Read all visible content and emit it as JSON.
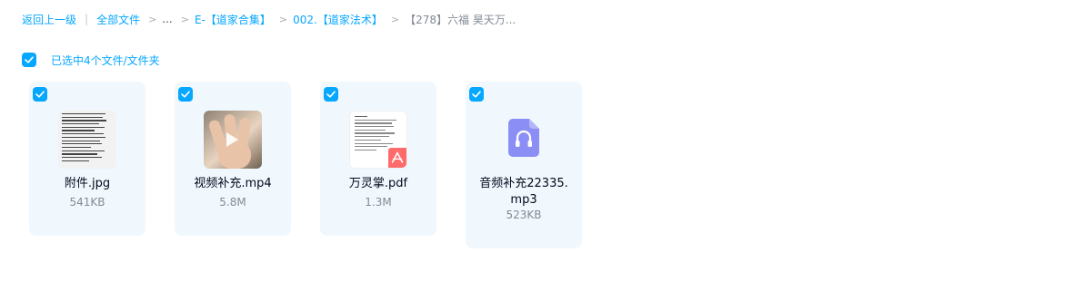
{
  "breadcrumb": {
    "back": "返回上一级",
    "divider": "|",
    "separator": ">",
    "items": [
      "全部文件",
      "...",
      "E-【道家合集】",
      "002.【道家法术】"
    ],
    "current": "【278】六福 昊天万..."
  },
  "selection": {
    "text": "已选中4个文件/文件夹"
  },
  "files": [
    {
      "name": "附件.jpg",
      "size": "541KB",
      "type": "image"
    },
    {
      "name": "视频补充.mp4",
      "size": "5.8M",
      "type": "video"
    },
    {
      "name": "万灵掌.pdf",
      "size": "1.3M",
      "type": "pdf"
    },
    {
      "name": "音频补充22335.mp3",
      "size": "523KB",
      "type": "audio"
    }
  ],
  "colors": {
    "accent": "#06a7ff",
    "card_bg": "#f0f8fd",
    "pdf_badge": "#ff6b6b",
    "audio_icon": "#8b8ff5"
  }
}
